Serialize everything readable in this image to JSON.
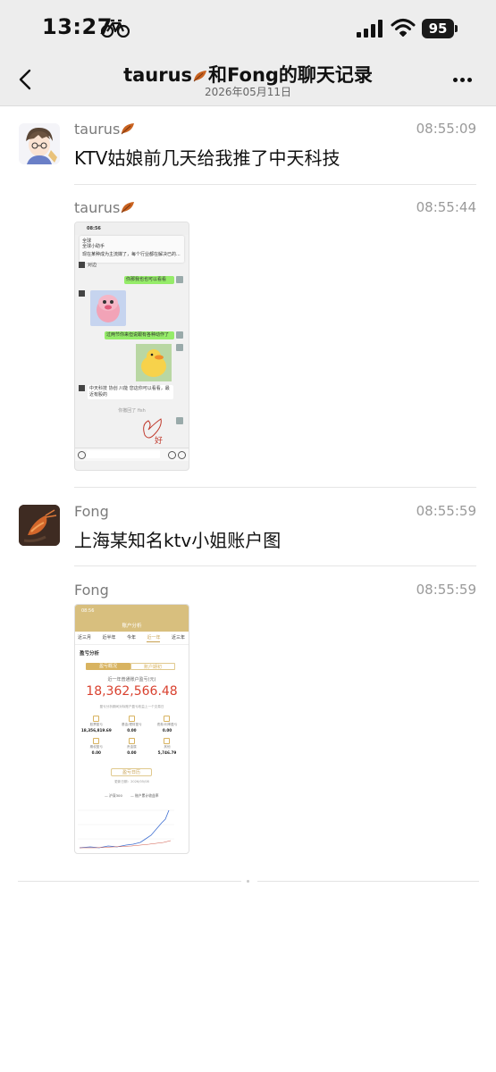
{
  "status_bar": {
    "time": "13:27",
    "battery": "95"
  },
  "header": {
    "title": "taurus🍂和Fong的聊天记录",
    "title_sender": "taurus",
    "title_rest": "和Fong的聊天记录",
    "subtitle": "2026年05月11日"
  },
  "messages": [
    {
      "sender": "taurus",
      "time": "08:55:09",
      "text": "KTV姑娘前几天给我推了中天科技"
    },
    {
      "sender": "taurus",
      "time": "08:55:44",
      "image": "chat-screenshot"
    },
    {
      "sender": "Fong",
      "time": "08:55:59",
      "text": "上海某知名ktv小姐账户图"
    },
    {
      "sender": "Fong",
      "time": "08:55:59",
      "image": "account-screenshot"
    }
  ],
  "chat_thumb": {
    "time": "08:56",
    "notif_title": "全球",
    "notif_sub": "全球小助手",
    "notif_body": "现在某种成为主流媒了，每个行业都在解决已的...",
    "line1": "对边",
    "bubble1": "你那我也也可以看看",
    "bubble2": "过两节你来但说跟有各种动作了",
    "msg3": "中天科技 协创 川能 您这你可以看看，最近有股的",
    "system": "你撤回了 fish",
    "sticker_text": "好"
  },
  "account_thumb": {
    "time": "08:56",
    "title": "账户分析",
    "tabs": [
      "近三月",
      "近半年",
      "今年",
      "近一年",
      "近三年"
    ],
    "active_tab": "近一年",
    "section": "盈亏分析",
    "toggle_left": "盈亏概况",
    "toggle_right": "账户期初",
    "caption": "近一年普通账户盈亏(元)",
    "big_value": "18,362,566.48",
    "note": "盈亏分析期间对标账户盈亏收益上一个交易日",
    "stats": [
      {
        "label": "股票盈亏",
        "value": "18,356,819.69"
      },
      {
        "label": "基金/理财盈亏",
        "value": "0.00"
      },
      {
        "label": "债券/利率盈亏",
        "value": "0.00"
      },
      {
        "label": "期权盈亏",
        "value": "0.00"
      },
      {
        "label": "贵金属",
        "value": "0.00"
      },
      {
        "label": "其他",
        "value": "5,746.79"
      }
    ],
    "button": "盈亏日历",
    "update": "更新日期：2026/05/08",
    "legend": [
      "沪深300",
      "账户累计收益率"
    ]
  }
}
